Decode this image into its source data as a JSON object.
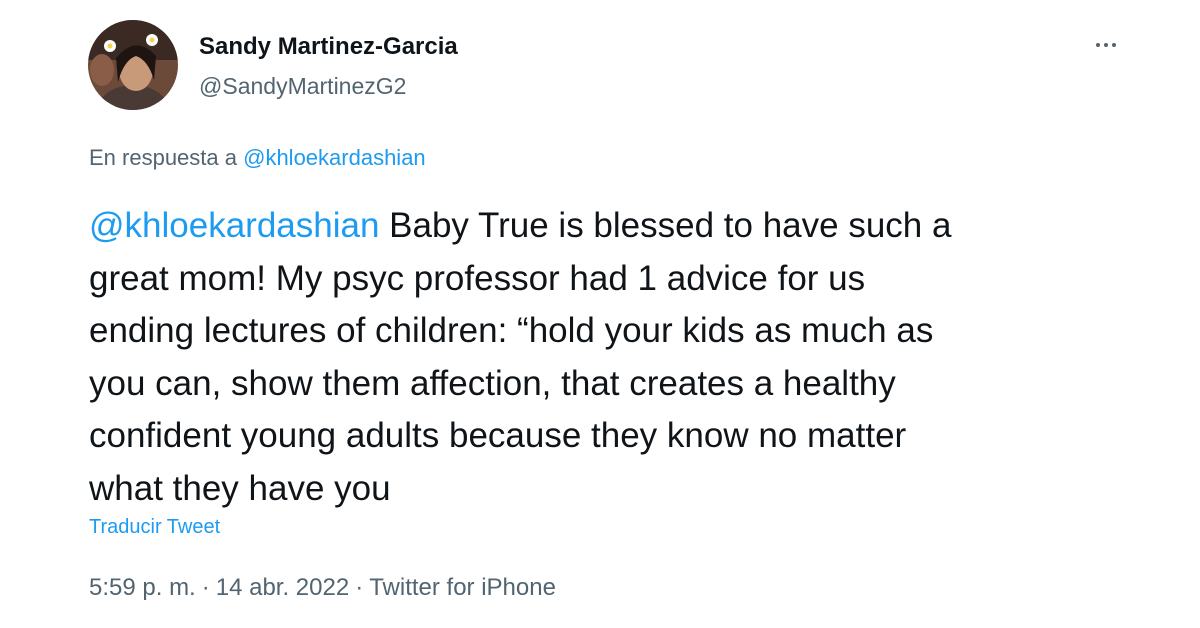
{
  "author": {
    "display_name": "Sandy Martinez-Garcia",
    "handle": "@SandyMartinezG2",
    "avatar_icon": "profile-photo"
  },
  "menu": {
    "icon": "more-options-icon"
  },
  "reply_context": {
    "prefix": "En respuesta a ",
    "mention": "@khloekardashian"
  },
  "tweet": {
    "mention": "@khloekardashian",
    "lines": [
      " Baby True is blessed to have such a",
      "great mom! My psyc professor had 1 advice for us",
      "ending lectures of children: “hold your kids as much as",
      "you can, show them affection, that creates a healthy",
      "confident young adults because they know no matter",
      "what they have you"
    ]
  },
  "translate_label": "Traducir Tweet",
  "meta": {
    "time": "5:59 p. m.",
    "separator": "·",
    "date": "14 abr. 2022",
    "source": "Twitter for iPhone"
  },
  "colors": {
    "link": "#1d9bf0",
    "secondary_text": "#536471",
    "primary_text": "#0f1419"
  }
}
